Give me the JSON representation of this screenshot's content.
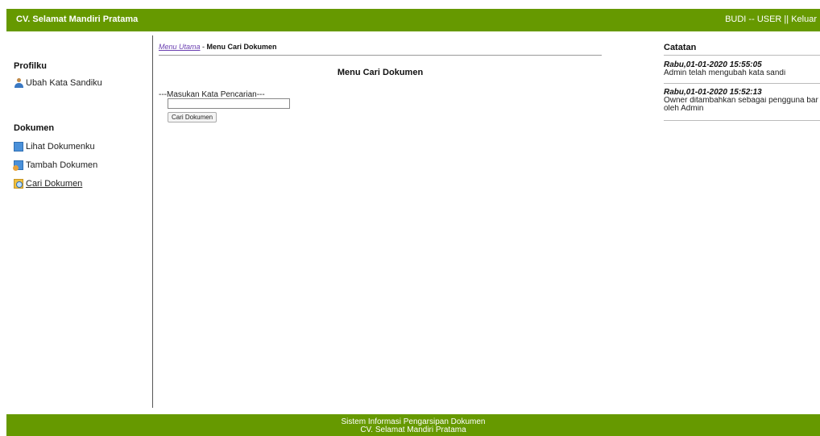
{
  "header": {
    "brand": "CV. Selamat Mandiri Pratama",
    "user_name": "BUDI",
    "separator": " -- ",
    "user_role": "USER",
    "divider": " || ",
    "logout_label": "Keluar"
  },
  "sidebar": {
    "profile_heading": "Profilku",
    "profile_items": [
      {
        "label": "Ubah Kata Sandiku",
        "icon": "user-icon"
      }
    ],
    "docs_heading": "Dokumen",
    "doc_items": [
      {
        "label": "Lihat Dokumenku",
        "icon": "document-icon"
      },
      {
        "label": "Tambah Dokumen",
        "icon": "add-document-icon"
      },
      {
        "label": "Cari Dokumen",
        "icon": "search-document-icon"
      }
    ]
  },
  "main": {
    "breadcrumb_link": "Menu Utama",
    "breadcrumb_sep": " - ",
    "breadcrumb_current": "Menu Cari Dokumen",
    "title": "Menu Cari Dokumen",
    "search_label": "---Masukan Kata Pencarian---",
    "search_value": "",
    "search_button": "Cari Dokumen"
  },
  "notes": {
    "title": "Catatan",
    "items": [
      {
        "when": "Rabu,01-01-2020 15:55:05",
        "lines": [
          "Admin telah mengubah kata sandi"
        ]
      },
      {
        "when": "Rabu,01-01-2020 15:52:13",
        "lines": [
          "Owner ditambahkan sebagai pengguna bar",
          "oleh Admin"
        ]
      }
    ]
  },
  "footer": {
    "line1": "Sistem Informasi Pengarsipan Dokumen",
    "line2": "CV. Selamat Mandiri Pratama"
  },
  "colors": {
    "bar_green": "#669900",
    "link_purple": "#6a3fb0"
  }
}
